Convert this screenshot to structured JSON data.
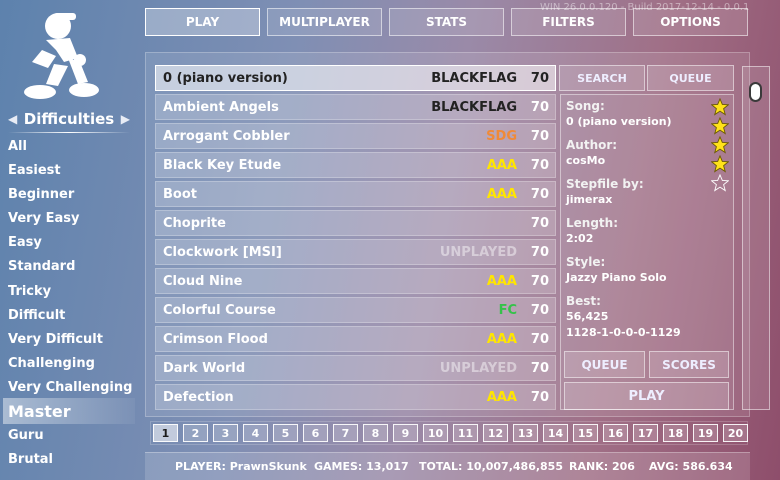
{
  "version": "WIN 26.0.0.120 - Build 2017-12-14 - 0.0.1",
  "nav": [
    {
      "label": "PLAY",
      "active": true
    },
    {
      "label": "MULTIPLAYER",
      "active": false
    },
    {
      "label": "STATS",
      "active": false
    },
    {
      "label": "FILTERS",
      "active": false
    },
    {
      "label": "OPTIONS",
      "active": false
    }
  ],
  "difficulties": {
    "title": "Difficulties",
    "items": [
      "All",
      "Easiest",
      "Beginner",
      "Very Easy",
      "Easy",
      "Standard",
      "Tricky",
      "Difficult",
      "Very Difficult",
      "Challenging",
      "Very Challenging",
      "Master",
      "Guru",
      "Brutal"
    ],
    "selected": "Master"
  },
  "songs": [
    {
      "name": "0 (piano version)",
      "grade": "BLACKFLAG",
      "grade_color": "#222222",
      "difficulty": "70",
      "selected": true
    },
    {
      "name": "Ambient Angels",
      "grade": "BLACKFLAG",
      "grade_color": "#222222",
      "difficulty": "70"
    },
    {
      "name": "Arrogant Cobbler",
      "grade": "SDG",
      "grade_color": "#f08a38",
      "difficulty": "70"
    },
    {
      "name": "Black Key Etude",
      "grade": "AAA",
      "grade_color": "#ffe600",
      "difficulty": "70"
    },
    {
      "name": "Boot",
      "grade": "AAA",
      "grade_color": "#ffe600",
      "difficulty": "70"
    },
    {
      "name": "Choprite",
      "grade": "",
      "grade_color": "",
      "difficulty": "70"
    },
    {
      "name": "Clockwork [MSI]",
      "grade": "UNPLAYED",
      "grade_color": "unplayed",
      "difficulty": "70"
    },
    {
      "name": "Cloud Nine",
      "grade": "AAA",
      "grade_color": "#ffe600",
      "difficulty": "70"
    },
    {
      "name": "Colorful Course",
      "grade": "FC",
      "grade_color": "#35c24a",
      "difficulty": "70"
    },
    {
      "name": "Crimson Flood",
      "grade": "AAA",
      "grade_color": "#ffe600",
      "difficulty": "70"
    },
    {
      "name": "Dark World",
      "grade": "UNPLAYED",
      "grade_color": "unplayed",
      "difficulty": "70"
    },
    {
      "name": "Defection",
      "grade": "AAA",
      "grade_color": "#ffe600",
      "difficulty": "70"
    }
  ],
  "side_buttons": {
    "search": "SEARCH",
    "queue": "QUEUE"
  },
  "info": {
    "song_label": "Song:",
    "song": "0 (piano version)",
    "author_label": "Author:",
    "author": "cosMo",
    "stepfile_label": "Stepfile by:",
    "stepfile": "jimerax",
    "length_label": "Length:",
    "length": "2:02",
    "style_label": "Style:",
    "style": "Jazzy Piano Solo",
    "best_label": "Best:",
    "best_score": "56,425",
    "best_judge": "1128-1-0-0-0-1129",
    "stars_filled": 4,
    "stars_total": 5
  },
  "info_buttons": {
    "queue": "QUEUE",
    "scores": "SCORES",
    "play": "PLAY"
  },
  "pages": [
    "1",
    "2",
    "3",
    "4",
    "5",
    "6",
    "7",
    "8",
    "9",
    "10",
    "11",
    "12",
    "13",
    "14",
    "15",
    "16",
    "17",
    "18",
    "19",
    "20"
  ],
  "current_page": "1",
  "footer": {
    "player": "PLAYER: PrawnSkunk",
    "games": "GAMES: 13,017",
    "total": "TOTAL: 10,007,486,855",
    "rank": "RANK: 206",
    "avg": "AVG: 586.634"
  }
}
